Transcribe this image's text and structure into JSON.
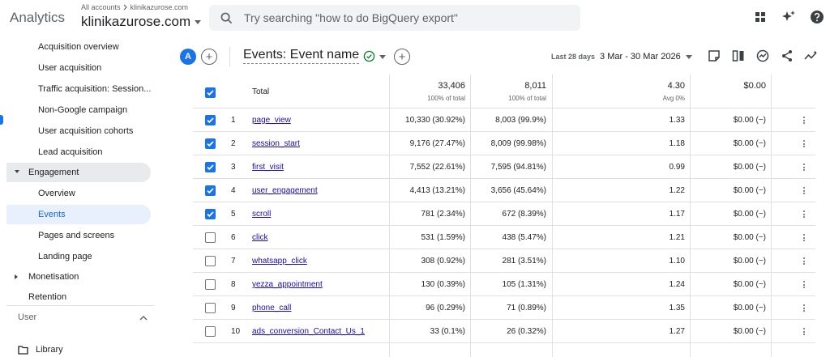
{
  "topbar": {
    "app_name": "Analytics",
    "breadcrumb_all": "All accounts",
    "breadcrumb_account": "klinikazurose.com",
    "property_name": "klinikazurose.com",
    "search_placeholder": "Try searching \"how to do BigQuery export\"",
    "icons": [
      "apps-grid-icon",
      "sparkle-insights-icon",
      "help-icon"
    ]
  },
  "sidebar": {
    "items": [
      {
        "label": "Acquisition overview",
        "level": "sub"
      },
      {
        "label": "User acquisition",
        "level": "sub"
      },
      {
        "label": "Traffic acquisition: Session...",
        "level": "sub"
      },
      {
        "label": "Non-Google campaign",
        "level": "sub"
      },
      {
        "label": "User acquisition cohorts",
        "level": "sub"
      },
      {
        "label": "Lead acquisition",
        "level": "sub"
      },
      {
        "label": "Engagement",
        "level": "top",
        "expanded": true
      },
      {
        "label": "Overview",
        "level": "sub"
      },
      {
        "label": "Events",
        "level": "sub",
        "selected": true
      },
      {
        "label": "Pages and screens",
        "level": "sub"
      },
      {
        "label": "Landing page",
        "level": "sub"
      },
      {
        "label": "Monetisation",
        "level": "top",
        "expanded": false
      },
      {
        "label": "Retention",
        "level": "top"
      }
    ],
    "section_user": "User",
    "library": "Library"
  },
  "report": {
    "avatar_letter": "A",
    "title": "Events: Event name",
    "date_label": "Last 28 days",
    "date_range": "3 Mar - 30 Mar 2026",
    "toolbar_icons": [
      "edit-report-icon",
      "compare-columns-icon",
      "insights-icon",
      "share-icon",
      "trend-icon",
      "pencil-icon"
    ]
  },
  "table": {
    "total": {
      "label": "Total",
      "event_count": "33,406",
      "event_count_sub": "100% of total",
      "total_users": "8,011",
      "total_users_sub": "100% of total",
      "per_user": "4.30",
      "per_user_sub": "Avg 0%",
      "revenue": "$0.00"
    },
    "rows": [
      {
        "idx": "1",
        "name": "page_view",
        "count": "10,330 (30.92%)",
        "users": "8,003 (99.9%)",
        "per_user": "1.33",
        "revenue": "$0.00 (−)",
        "checked": true
      },
      {
        "idx": "2",
        "name": "session_start",
        "count": "9,176 (27.47%)",
        "users": "8,009 (99.98%)",
        "per_user": "1.18",
        "revenue": "$0.00 (−)",
        "checked": true
      },
      {
        "idx": "3",
        "name": "first_visit",
        "count": "7,552 (22.61%)",
        "users": "7,595 (94.81%)",
        "per_user": "0.99",
        "revenue": "$0.00 (−)",
        "checked": true
      },
      {
        "idx": "4",
        "name": "user_engagement",
        "count": "4,413 (13.21%)",
        "users": "3,656 (45.64%)",
        "per_user": "1.22",
        "revenue": "$0.00 (−)",
        "checked": true
      },
      {
        "idx": "5",
        "name": "scroll",
        "count": "781 (2.34%)",
        "users": "672 (8.39%)",
        "per_user": "1.17",
        "revenue": "$0.00 (−)",
        "checked": true
      },
      {
        "idx": "6",
        "name": "click",
        "count": "531 (1.59%)",
        "users": "438 (5.47%)",
        "per_user": "1.21",
        "revenue": "$0.00 (−)",
        "checked": false
      },
      {
        "idx": "7",
        "name": "whatsapp_click",
        "count": "308 (0.92%)",
        "users": "281 (3.51%)",
        "per_user": "1.10",
        "revenue": "$0.00 (−)",
        "checked": false
      },
      {
        "idx": "8",
        "name": "yezza_appointment",
        "count": "130 (0.39%)",
        "users": "105 (1.31%)",
        "per_user": "1.24",
        "revenue": "$0.00 (−)",
        "checked": false
      },
      {
        "idx": "9",
        "name": "phone_call",
        "count": "96 (0.29%)",
        "users": "71 (0.89%)",
        "per_user": "1.35",
        "revenue": "$0.00 (−)",
        "checked": false
      },
      {
        "idx": "10",
        "name": "ads_conversion_Contact_Us_1",
        "count": "33 (0.1%)",
        "users": "26 (0.32%)",
        "per_user": "1.27",
        "revenue": "$0.00 (−)",
        "checked": false
      }
    ]
  },
  "colors": {
    "accent": "#1a73e8",
    "link": "#1a0dab",
    "selected_bg": "#e8f0fe",
    "hover_bg": "#e8eaed"
  }
}
